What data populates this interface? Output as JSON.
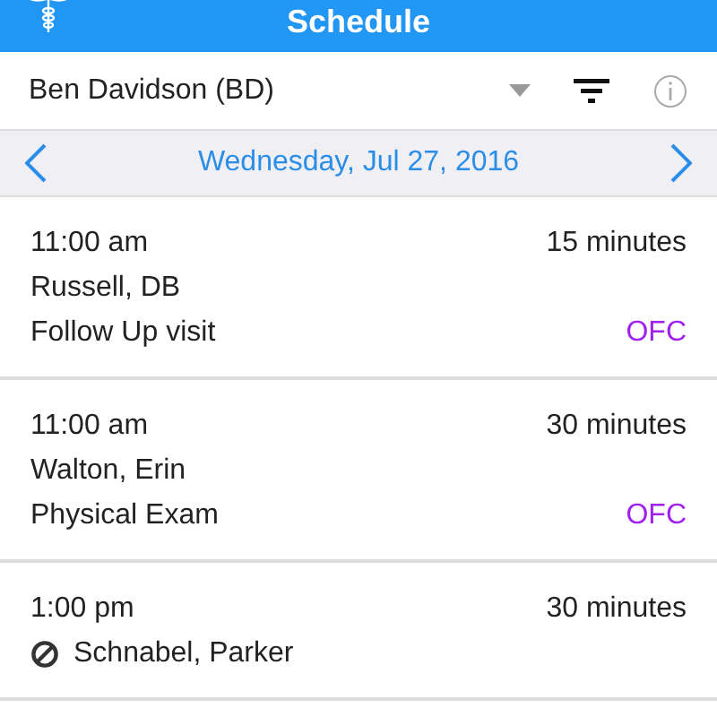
{
  "header": {
    "title": "Schedule"
  },
  "provider": {
    "name": "Ben Davidson (BD)"
  },
  "date_bar": {
    "date": "Wednesday, Jul 27, 2016"
  },
  "appointments": [
    {
      "time": "11:00 am",
      "duration": "15 minutes",
      "patient": "Russell, DB",
      "visit_type": "Follow Up visit",
      "location": "OFC",
      "cancelled": false
    },
    {
      "time": "11:00 am",
      "duration": "30 minutes",
      "patient": "Walton, Erin",
      "visit_type": "Physical Exam",
      "location": "OFC",
      "cancelled": false
    },
    {
      "time": "1:00 pm",
      "duration": "30 minutes",
      "patient": "Schnabel, Parker",
      "cancelled": true
    }
  ]
}
